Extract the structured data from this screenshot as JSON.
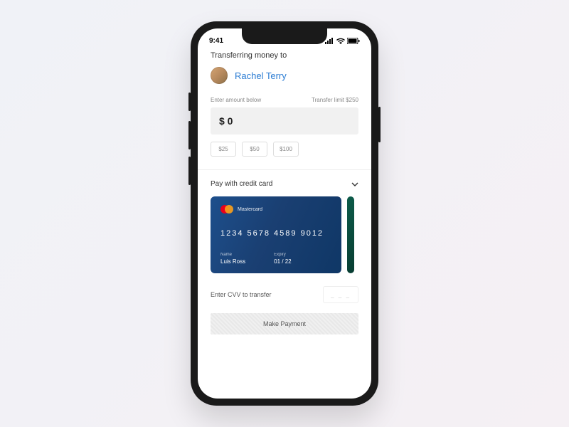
{
  "status": {
    "time": "9:41"
  },
  "heading": "Transferring money to",
  "recipient": {
    "name": "Rachel Terry"
  },
  "amount": {
    "label": "Enter amount below",
    "limit": "Transfer limit $250",
    "value": "$ 0",
    "quick": [
      "$25",
      "$50",
      "$100"
    ]
  },
  "pay": {
    "header": "Pay with credit card",
    "card": {
      "brand": "Mastercard",
      "number": "1234   5678   4589   9012",
      "name_label": "Name",
      "name": "Luis Ross",
      "expiry_label": "Expiry",
      "expiry": "01 / 22"
    }
  },
  "cvv": {
    "label": "Enter CVV to transfer",
    "placeholder": "_ _ _"
  },
  "button": "Make Payment"
}
